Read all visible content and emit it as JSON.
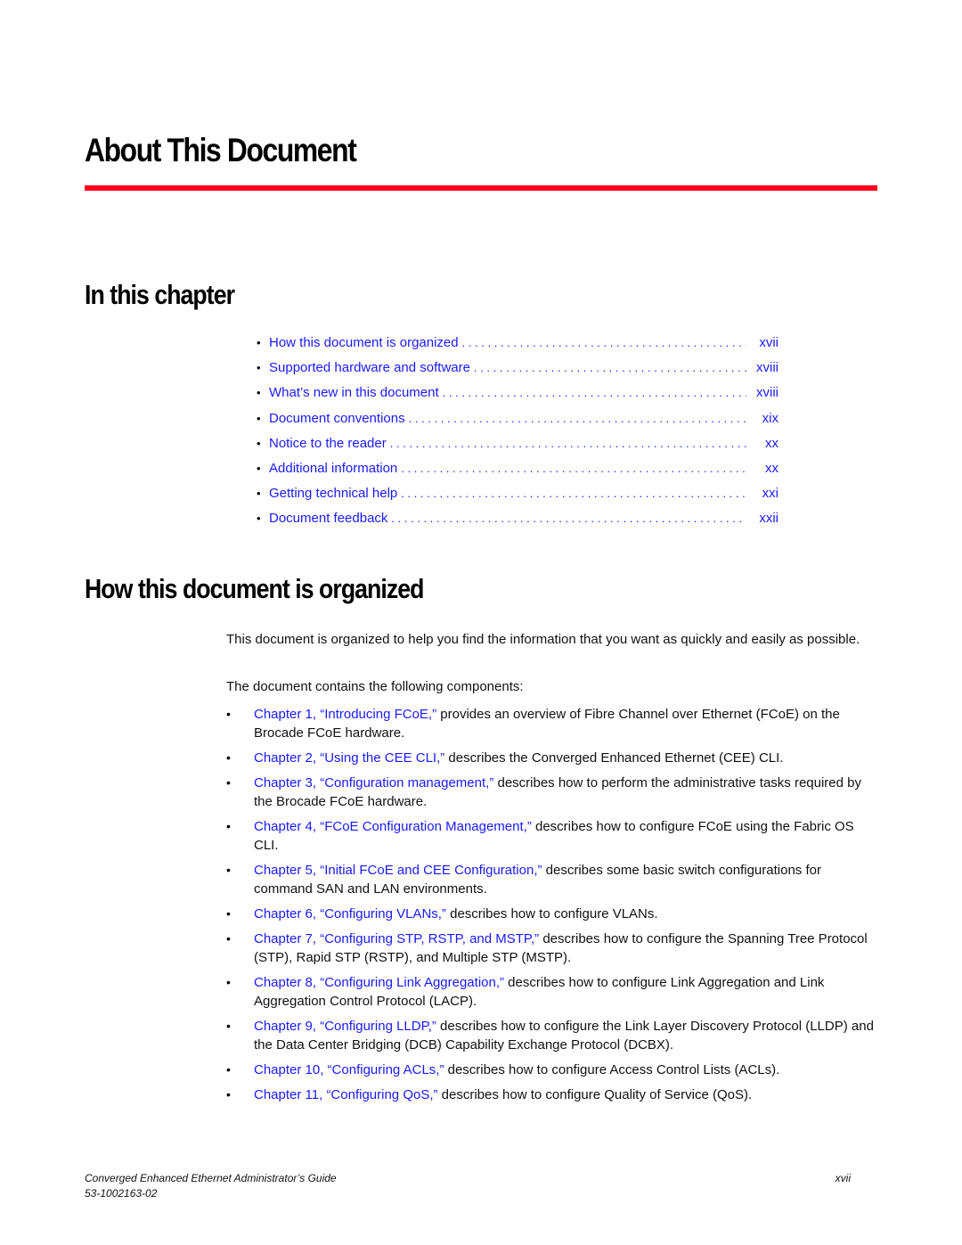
{
  "chapter": {
    "title": "About This Document",
    "accent_color": "#ff0022",
    "link_color": "#1a1aff"
  },
  "in_this_chapter": {
    "heading": "In this chapter",
    "toc": [
      {
        "label": "How this document is organized",
        "page": "xvii"
      },
      {
        "label": "Supported hardware and software",
        "page": "xviii"
      },
      {
        "label": "What’s new in this document",
        "page": "xviii"
      },
      {
        "label": "Document conventions",
        "page": "xix"
      },
      {
        "label": "Notice to the reader",
        "page": "xx"
      },
      {
        "label": "Additional information",
        "page": "xx"
      },
      {
        "label": "Getting technical help",
        "page": "xxi"
      },
      {
        "label": "Document feedback",
        "page": "xxii"
      }
    ]
  },
  "how_organized": {
    "heading": "How this document is organized",
    "intro": "This document is organized to help you find the information that you want as quickly and easily as possible.",
    "lead_in": "The document contains the following components:",
    "components": [
      {
        "link": "Chapter 1, “Introducing FCoE,”",
        "text": " provides an overview of Fibre Channel over Ethernet (FCoE) on the Brocade FCoE hardware."
      },
      {
        "link": "Chapter 2, “Using the CEE CLI,”",
        "text": " describes the Converged Enhanced Ethernet (CEE) CLI."
      },
      {
        "link": "Chapter 3, “Configuration management,”",
        "text": " describes how to perform the administrative tasks required by the Brocade FCoE hardware."
      },
      {
        "link": "Chapter 4, “FCoE Configuration Management,”",
        "text": " describes how to configure FCoE using the Fabric OS CLI."
      },
      {
        "link": "Chapter 5, “Initial FCoE and CEE Configuration,”",
        "text": " describes some basic switch configurations for command SAN and LAN environments."
      },
      {
        "link": "Chapter 6, “Configuring VLANs,”",
        "text": " describes how to configure VLANs."
      },
      {
        "link": "Chapter 7, “Configuring STP, RSTP, and MSTP,”",
        "text": " describes how to configure the Spanning Tree Protocol (STP), Rapid STP (RSTP), and Multiple STP (MSTP)."
      },
      {
        "link": "Chapter 8, “Configuring Link Aggregation,”",
        "text": " describes how to configure Link Aggregation and Link Aggregation Control Protocol (LACP)."
      },
      {
        "link": "Chapter 9, “Configuring LLDP,”",
        "text": " describes how to configure the Link Layer Discovery Protocol (LLDP) and the Data Center Bridging (DCB) Capability Exchange Protocol (DCBX)."
      },
      {
        "link": "Chapter 10, “Configuring ACLs,”",
        "text": " describes how to configure Access Control Lists (ACLs)."
      },
      {
        "link": "Chapter 11, “Configuring QoS,”",
        "text": " describes how to configure Quality of Service (QoS)."
      }
    ]
  },
  "footer": {
    "title": "Converged Enhanced Ethernet Administrator’s Guide",
    "doc_number": "53-1002163-02",
    "page": "xvii"
  },
  "icons": {
    "bullet": "•"
  }
}
